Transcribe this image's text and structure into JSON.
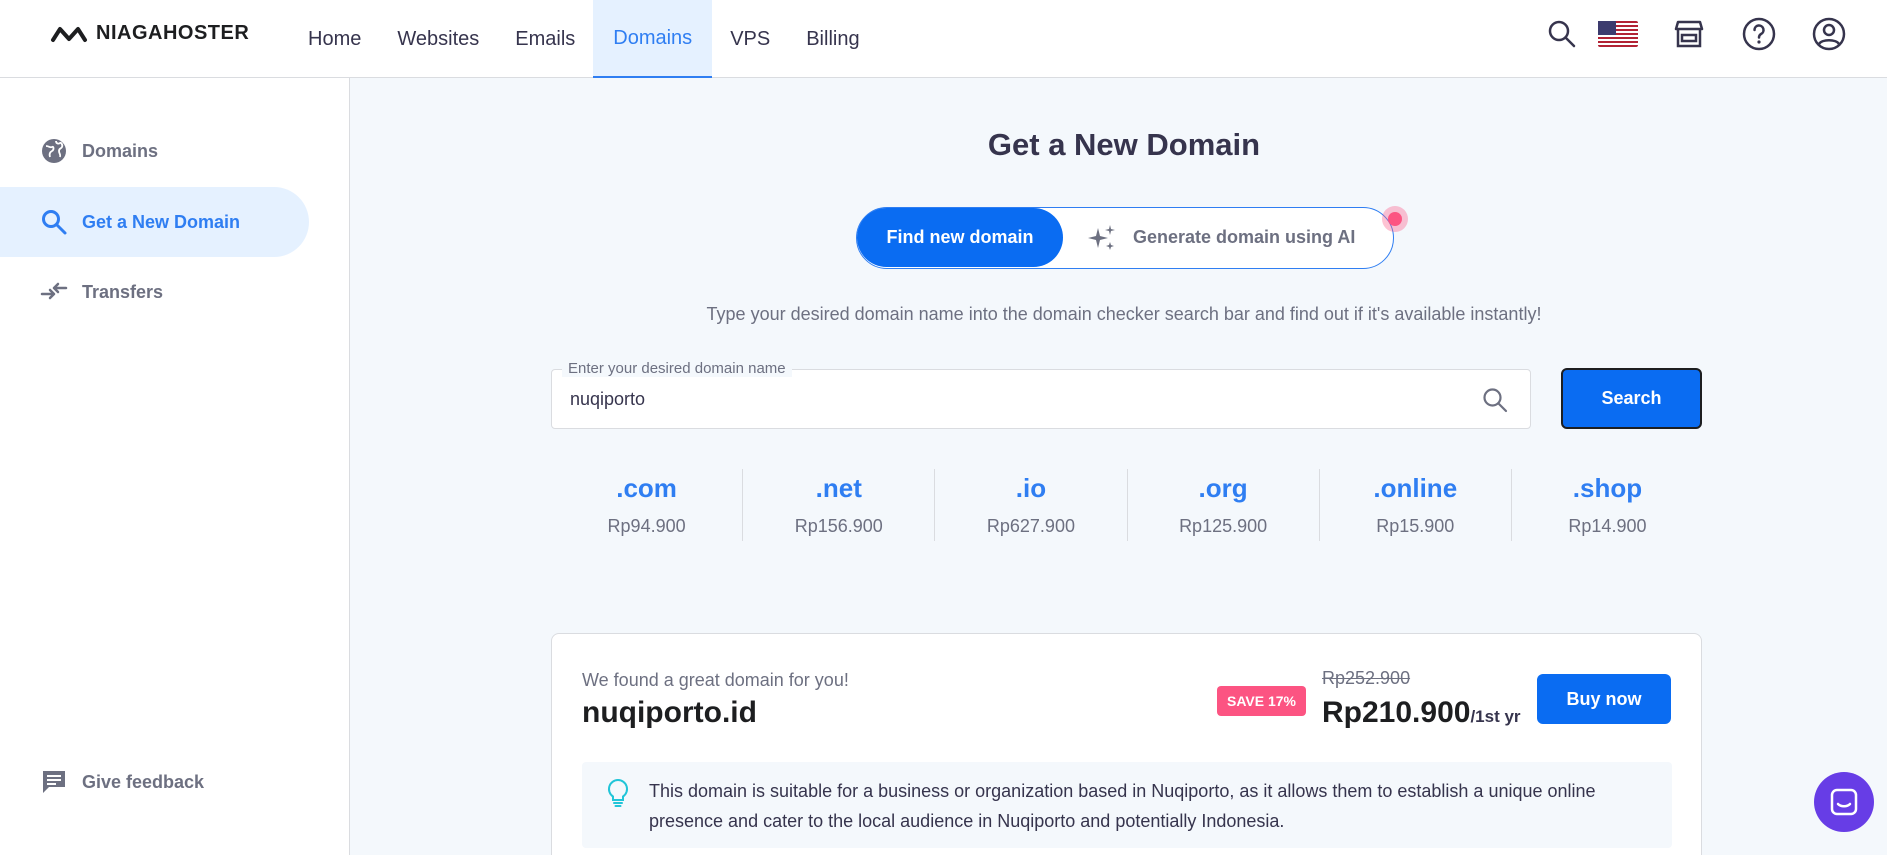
{
  "brand": {
    "name": "NIAGAHOSTER"
  },
  "nav": {
    "items": [
      {
        "label": "Home"
      },
      {
        "label": "Websites"
      },
      {
        "label": "Emails"
      },
      {
        "label": "Domains",
        "active": true
      },
      {
        "label": "VPS"
      },
      {
        "label": "Billing"
      }
    ]
  },
  "header_icons": [
    "search-icon",
    "us-flag-icon",
    "store-icon",
    "help-icon",
    "account-icon"
  ],
  "sidebar": {
    "items": [
      {
        "label": "Domains",
        "icon": "globe-icon"
      },
      {
        "label": "Get a New Domain",
        "icon": "search-icon",
        "active": true
      },
      {
        "label": "Transfers",
        "icon": "transfer-icon"
      }
    ],
    "feedback": {
      "label": "Give feedback",
      "icon": "feedback-icon"
    }
  },
  "main": {
    "title": "Get a New Domain",
    "toggle": {
      "find_label": "Find new domain",
      "ai_label": "Generate domain using AI"
    },
    "subtitle": "Type your desired domain name into the domain checker search bar and find out if it's available instantly!",
    "search": {
      "label": "Enter your desired domain name",
      "value": "nuqiporto",
      "button_label": "Search"
    },
    "tlds": [
      {
        "name": ".com",
        "price": "Rp94.900"
      },
      {
        "name": ".net",
        "price": "Rp156.900"
      },
      {
        "name": ".io",
        "price": "Rp627.900"
      },
      {
        "name": ".org",
        "price": "Rp125.900"
      },
      {
        "name": ".online",
        "price": "Rp15.900"
      },
      {
        "name": ".shop",
        "price": "Rp14.900"
      }
    ],
    "result": {
      "found_text": "We found a great domain for you!",
      "domain": "nuqiporto.id",
      "badge": "SAVE 17%",
      "old_price": "Rp252.900",
      "new_price": "Rp210.900",
      "period": "/1st yr",
      "buy_label": "Buy now",
      "tip": "This domain is suitable for a business or organization based in Nuqiporto, as it allows them to establish a unique online presence and cater to the local audience in Nuqiporto and potentially Indonesia."
    }
  },
  "colors": {
    "primary": "#0a6cf2",
    "accent_link": "#2f7ef2",
    "badge": "#fc5482",
    "chat": "#673de6"
  }
}
